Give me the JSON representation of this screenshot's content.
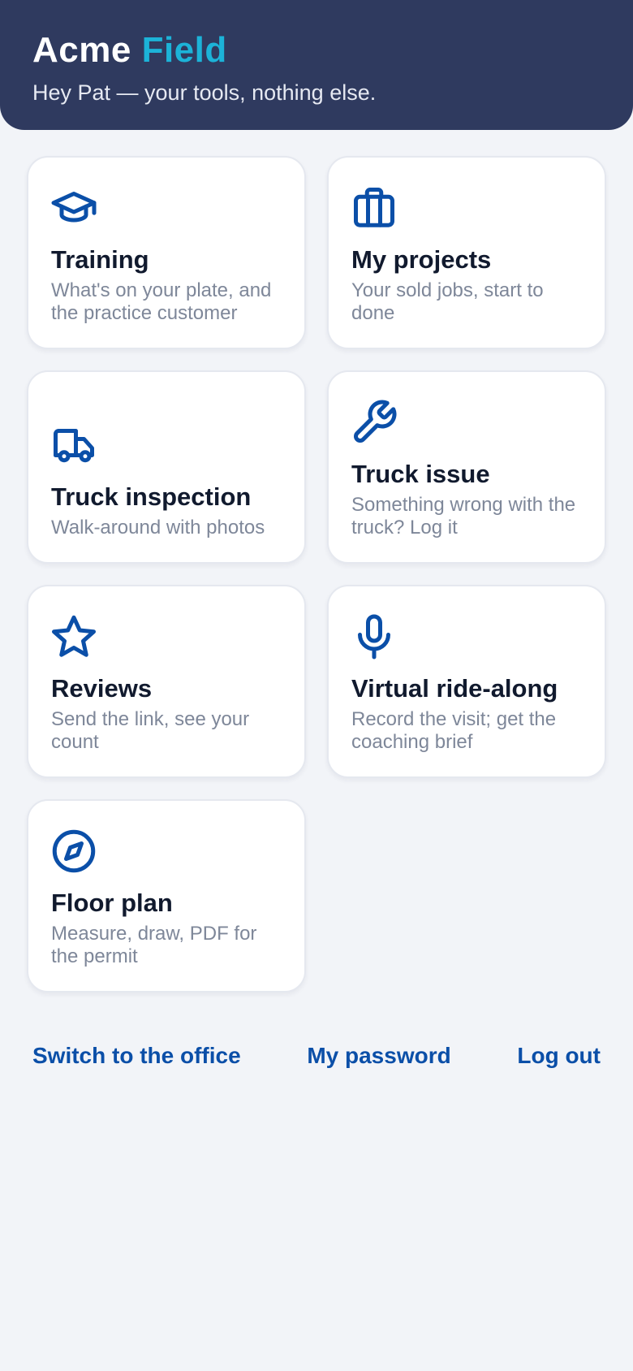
{
  "header": {
    "brand_primary": "Acme",
    "brand_accent": "Field",
    "subtitle": "Hey Pat — your tools, nothing else."
  },
  "tiles": [
    {
      "icon": "graduation-cap-icon",
      "title": "Training",
      "description": "What's on your plate, and the practice customer"
    },
    {
      "icon": "briefcase-icon",
      "title": "My projects",
      "description": "Your sold jobs, start to done"
    },
    {
      "icon": "truck-icon",
      "title": "Truck inspection",
      "description": "Walk-around with photos"
    },
    {
      "icon": "wrench-icon",
      "title": "Truck issue",
      "description": "Something wrong with the truck? Log it"
    },
    {
      "icon": "star-icon",
      "title": "Reviews",
      "description": "Send the link, see your count"
    },
    {
      "icon": "microphone-icon",
      "title": "Virtual ride-along",
      "description": "Record the visit; get the coaching brief"
    },
    {
      "icon": "compass-icon",
      "title": "Floor plan",
      "description": "Measure, draw, PDF for the permit"
    }
  ],
  "footer": {
    "switch_label": "Switch to the office",
    "password_label": "My password",
    "logout_label": "Log out"
  },
  "colors": {
    "header_bg": "#2f3a5f",
    "accent": "#1cb3d8",
    "icon": "#0b4fa8",
    "link": "#0b4fa8"
  }
}
